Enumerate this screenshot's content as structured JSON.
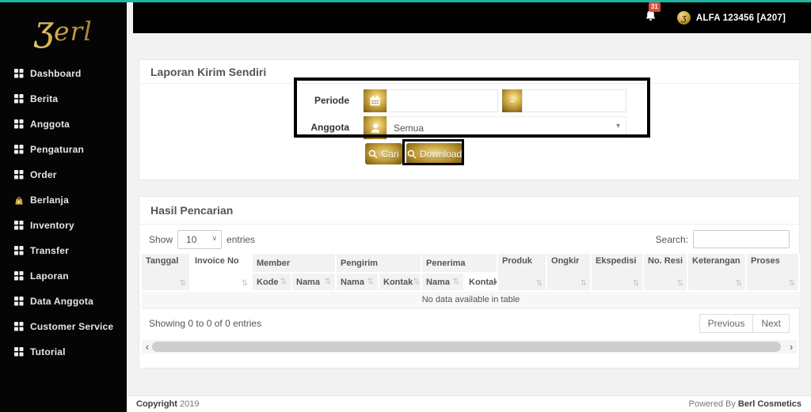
{
  "colors": {
    "accent_teal": "#23b3a2",
    "gold": "#c9a43f",
    "badge_red": "#dd4b39",
    "sidebar_bg": "#050505",
    "topbar_bg": "#000000"
  },
  "glyphs": {
    "sort": "⇅",
    "caret_down": "▾",
    "select_arrow": "∨",
    "chevron_left": "‹",
    "chevron_right": "›",
    "dash": "-"
  },
  "sidebar": {
    "logo_mark": "ʒ",
    "logo_text": "erl",
    "items": [
      {
        "label": "Dashboard",
        "icon": "grid-icon"
      },
      {
        "label": "Berita",
        "icon": "grid-icon"
      },
      {
        "label": "Anggota",
        "icon": "grid-icon"
      },
      {
        "label": "Pengaturan",
        "icon": "grid-icon"
      },
      {
        "label": "Order",
        "icon": "grid-icon"
      },
      {
        "label": "Berlanja",
        "icon": "shopping-bag-icon"
      },
      {
        "label": "Inventory",
        "icon": "grid-icon"
      },
      {
        "label": "Transfer",
        "icon": "grid-icon"
      },
      {
        "label": "Laporan",
        "icon": "grid-icon"
      },
      {
        "label": "Data Anggota",
        "icon": "grid-icon"
      },
      {
        "label": "Customer Service",
        "icon": "grid-icon"
      },
      {
        "label": "Tutorial",
        "icon": "grid-icon"
      }
    ]
  },
  "topbar": {
    "notification_count": "31",
    "username": "ALFA 123456 [A207]"
  },
  "filter": {
    "title": "Laporan Kirim Sendiri",
    "periode_label": "Periode",
    "periode_from_value": "",
    "periode_to_value": "",
    "anggota_label": "Anggota",
    "anggota_value": "Semua",
    "cari_label": "Cari",
    "download_label": "Download"
  },
  "results": {
    "title": "Hasil Pencarian",
    "show_label": "Show",
    "page_size": "10",
    "entries_label": "entries",
    "search_label": "Search:",
    "search_value": "",
    "headers": {
      "tanggal": "Tanggal",
      "invoice": "Invoice No",
      "member": "Member",
      "pengirim": "Pengirim",
      "penerima": "Penerima",
      "kode": "Kode",
      "nama": "Nama",
      "kontak": "Kontak",
      "produk": "Produk",
      "ongkir": "Ongkir",
      "ekspedisi": "Ekspedisi",
      "no_resi": "No. Resi",
      "keterangan": "Keterangan",
      "proses": "Proses"
    },
    "empty_text": "No data available in table",
    "info_text": "Showing 0 to 0 of 0 entries",
    "prev_label": "Previous",
    "next_label": "Next"
  },
  "footer": {
    "copyright_label": "Copyright",
    "year": "2019",
    "powered_label": "Powered By",
    "brand": "Berl Cosmetics"
  }
}
